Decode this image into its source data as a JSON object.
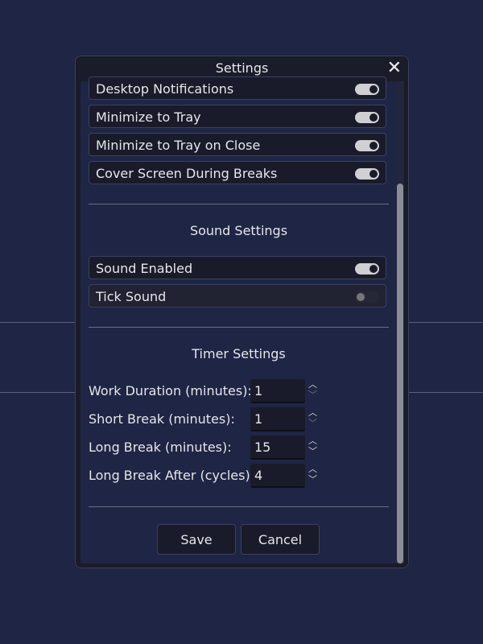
{
  "dialog": {
    "title": "Settings"
  },
  "general": [
    {
      "label": "Desktop Notifications",
      "on": true
    },
    {
      "label": "Minimize to Tray",
      "on": true
    },
    {
      "label": "Minimize to Tray on Close",
      "on": true
    },
    {
      "label": "Cover Screen During Breaks",
      "on": true
    }
  ],
  "sound": {
    "title": "Sound Settings",
    "items": [
      {
        "label": "Sound Enabled",
        "on": true
      },
      {
        "label": "Tick Sound",
        "on": false
      }
    ]
  },
  "timer": {
    "title": "Timer Settings",
    "fields": [
      {
        "label": "Work Duration (minutes):",
        "value": "1",
        "down_enabled": false
      },
      {
        "label": "Short Break (minutes):",
        "value": "1",
        "down_enabled": false
      },
      {
        "label": "Long Break (minutes):",
        "value": "15",
        "down_enabled": true
      },
      {
        "label": "Long Break After (cycles):",
        "value": "4",
        "down_enabled": true
      }
    ]
  },
  "buttons": {
    "save": "Save",
    "cancel": "Cancel"
  }
}
